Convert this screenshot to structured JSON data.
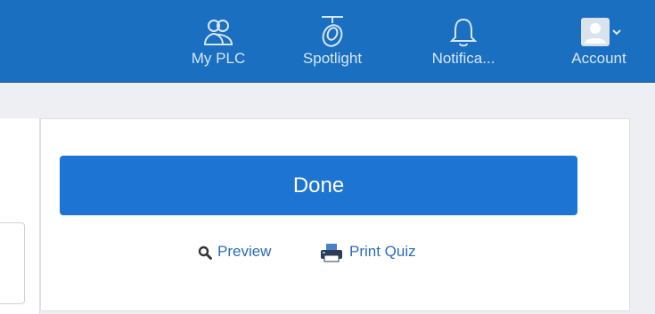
{
  "nav": {
    "items": [
      {
        "label": "My PLC",
        "icon": "my-plc-icon"
      },
      {
        "label": "Spotlight",
        "icon": "spotlight-icon"
      },
      {
        "label": "Notifica...",
        "icon": "bell-icon"
      },
      {
        "label": "Account",
        "icon": "avatar-icon"
      }
    ]
  },
  "actions": {
    "done_label": "Done",
    "preview_label": "Preview",
    "print_label": "Print Quiz"
  },
  "colors": {
    "topbar": "#1b6fc0",
    "primary_button": "#1e74d2",
    "link": "#2a6cbf"
  }
}
